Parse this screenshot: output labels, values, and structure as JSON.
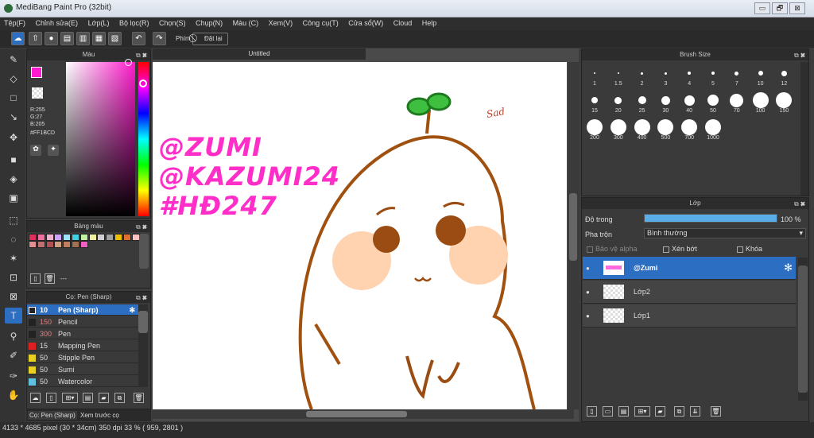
{
  "window": {
    "title": "MediBang Paint Pro (32bit)",
    "min": "▭",
    "max": "🗗",
    "close": "⊠"
  },
  "menu": [
    "Tệp(F)",
    "Chỉnh sửa(E)",
    "Lớp(L)",
    "Bộ lọc(R)",
    "Chọn(S)",
    "Chụp(N)",
    "Màu (C)",
    "Xem(V)",
    "Công cụ(T)",
    "Cửa sổ(W)",
    "Cloud",
    "Help"
  ],
  "toolbar": {
    "phim_label": "Phím",
    "reset_label": "Đặt lại"
  },
  "color_panel": {
    "title": "Màu",
    "r": "R:255",
    "g": "G:27",
    "b": "B:205",
    "hex": "#FF1BCD",
    "primary_color": "#ff1bcd"
  },
  "palette_panel": {
    "title": "Bảng màu",
    "colors": [
      "#e0305a",
      "#f070a0",
      "#f0b0d0",
      "#d0a0ff",
      "#a0e0ff",
      "#40d0e0",
      "#c0f0a0",
      "#f0f0a0",
      "#d0d0d0",
      "#a0a0a0",
      "#f0c000",
      "#e07030",
      "#ffc0c0",
      "#e09090",
      "#c07070",
      "#b05050",
      "#d0a080",
      "#c08060",
      "#a07050",
      "#f060c0"
    ],
    "dash": "---"
  },
  "brush_panel": {
    "title": "Cọ: Pen (Sharp)",
    "items": [
      {
        "size": "10",
        "name": "Pen (Sharp)",
        "color": "#222222",
        "selected": true
      },
      {
        "size": "150",
        "name": "Pencil",
        "color": "#222222",
        "selected": false
      },
      {
        "size": "300",
        "name": "Pen",
        "color": "#222222",
        "selected": false
      },
      {
        "size": "15",
        "name": "Mapping Pen",
        "color": "#e02020",
        "selected": false
      },
      {
        "size": "50",
        "name": "Stipple Pen",
        "color": "#e8d020",
        "selected": false
      },
      {
        "size": "50",
        "name": "Sumi",
        "color": "#e8d020",
        "selected": false
      },
      {
        "size": "50",
        "name": "Watercolor",
        "color": "#60c0e0",
        "selected": false
      }
    ]
  },
  "bottom_tabs": [
    "Cọ: Pen (Sharp)",
    "Xem trước cọ"
  ],
  "document": {
    "tab": "Untitled",
    "sticker_lines": [
      "@ZUMI",
      "@KAZUMI24",
      "#HĐ247"
    ],
    "signature": "Sad"
  },
  "brush_size_panel": {
    "title": "Brush Size",
    "sizes": [
      "1",
      "1.5",
      "2",
      "3",
      "4",
      "5",
      "7",
      "10",
      "12",
      "15",
      "20",
      "25",
      "30",
      "40",
      "50",
      "70",
      "100",
      "150",
      "200",
      "300",
      "400",
      "500",
      "700",
      "1000"
    ]
  },
  "layer_panel": {
    "title": "Lớp",
    "opacity_label": "Độ trong",
    "opacity_value": "100 %",
    "opacity_fraction": 1.0,
    "blend_label": "Pha trộn",
    "blend_value": "Bình thường",
    "protect_alpha": "Bảo vệ alpha",
    "clip": "Xén bớt",
    "lock": "Khóa",
    "layers": [
      {
        "name": "@Zumi",
        "selected": true
      },
      {
        "name": "Lớp2",
        "selected": false
      },
      {
        "name": "Lớp1",
        "selected": false
      }
    ]
  },
  "status": "4133 * 4685 pixel  (30 * 34cm)  350 dpi  33 %  ( 959, 2801 )"
}
